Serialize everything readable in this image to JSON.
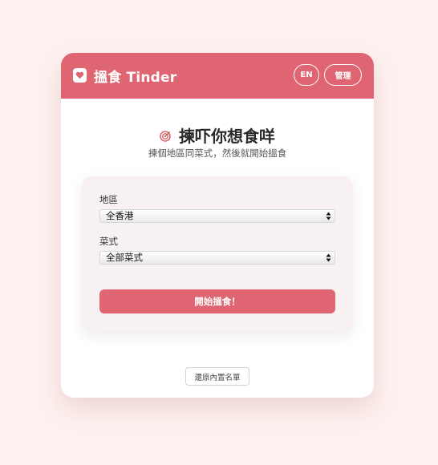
{
  "header": {
    "brand_icon": "card-heart-icon",
    "title": "搵食 Tinder",
    "lang_button": "EN",
    "admin_button": "管理",
    "color": "#e06573"
  },
  "main": {
    "title_icon": "target-icon",
    "title": "揀吓你想食咩",
    "subtitle": "揀個地區同菜式，然後就開始搵食"
  },
  "form": {
    "region_label": "地區",
    "region_value": "全香港",
    "cuisine_label": "菜式",
    "cuisine_value": "全部菜式",
    "start_button": "開始搵食！"
  },
  "footer": {
    "reset_button": "還原內置名單"
  }
}
